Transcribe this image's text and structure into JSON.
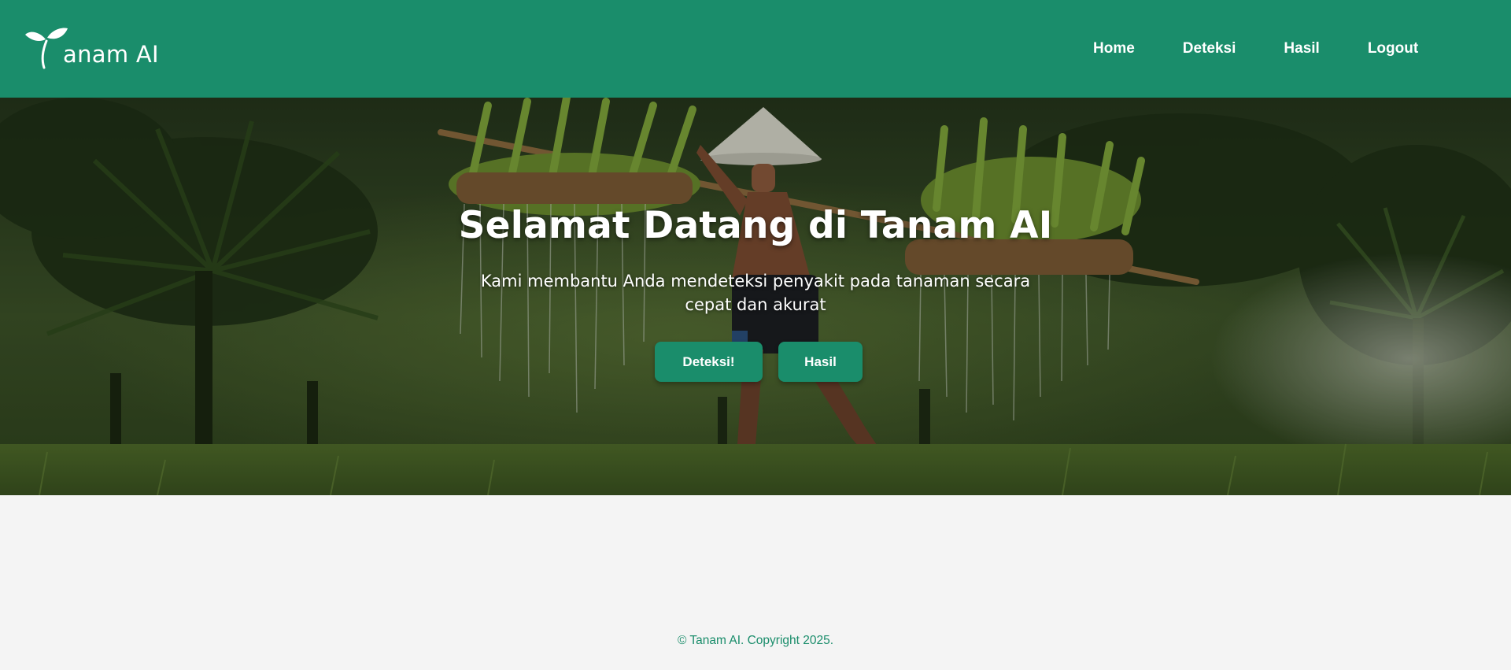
{
  "navbar": {
    "logo_text": "anam AI",
    "links": [
      {
        "label": "Home"
      },
      {
        "label": "Deteksi"
      },
      {
        "label": "Hasil"
      },
      {
        "label": "Logout"
      }
    ],
    "color": "#1a8d6b"
  },
  "hero": {
    "title": "Selamat Datang di Tanam AI",
    "subtitle": "Kami membantu Anda mendeteksi penyakit pada tanaman secara cepat dan akurat",
    "buttons": {
      "deteksi_label": "Deteksi!",
      "hasil_label": "Hasil"
    },
    "background": "farmer-carrying-rice-seedlings-photo"
  },
  "footer": {
    "text": "© Tanam AI. Copyright 2025."
  },
  "colors": {
    "primary": "#1a8d6b",
    "page_background": "#f4f4f4"
  },
  "icons": {
    "logo": "sprout-icon"
  }
}
